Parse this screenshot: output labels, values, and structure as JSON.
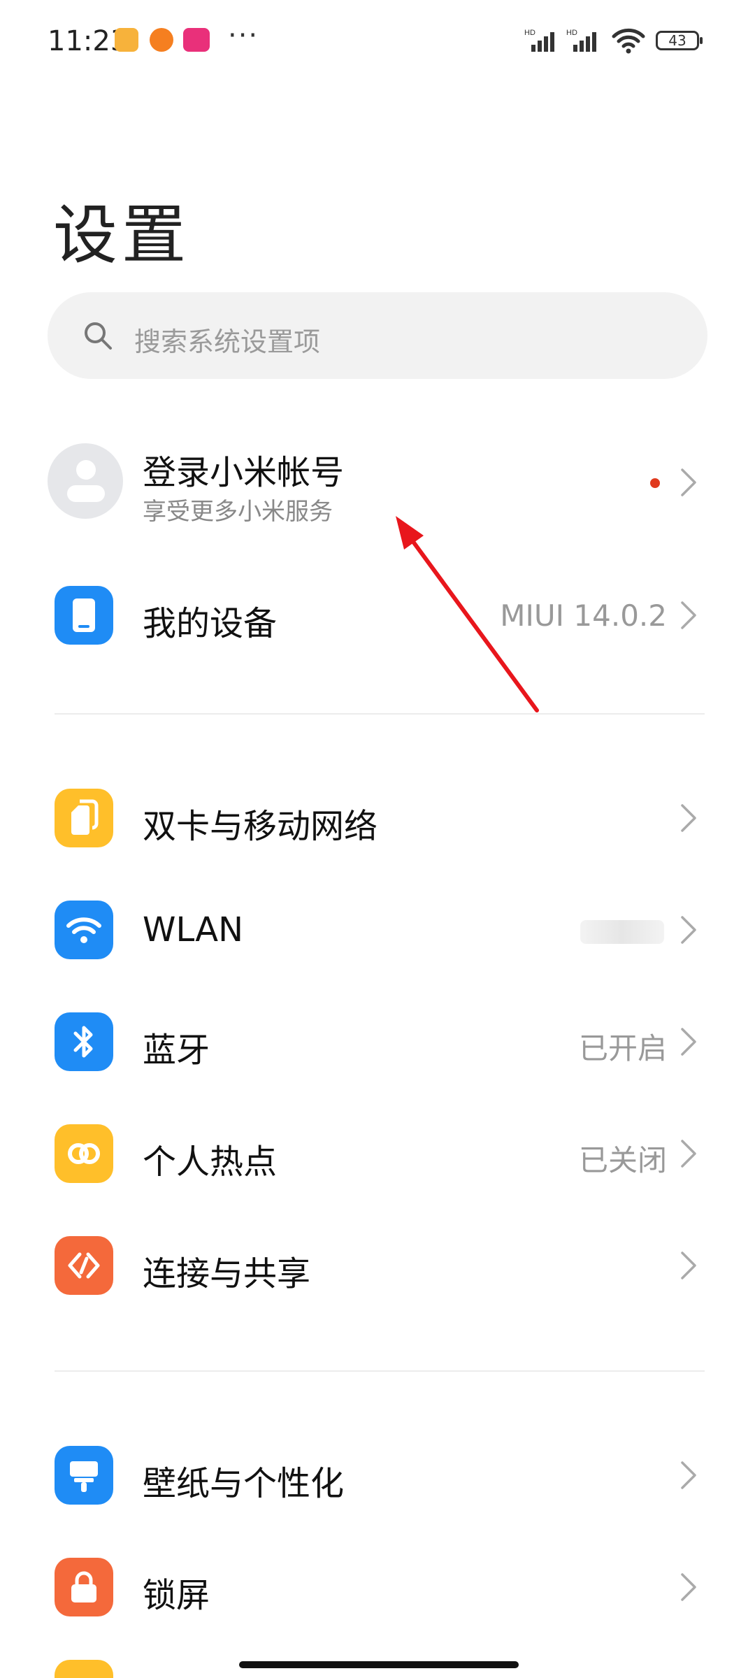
{
  "status_bar": {
    "time": "11:23",
    "notification_dots": "···",
    "signal1_label": "HD",
    "signal2_label": "HD",
    "battery": "43"
  },
  "page_title": "设置",
  "search": {
    "placeholder": "搜索系统设置项"
  },
  "account": {
    "title": "登录小米帐号",
    "subtitle": "享受更多小米服务"
  },
  "items": [
    {
      "label": "我的设备",
      "value": "MIUI 14.0.2",
      "icon": "phone-icon",
      "color": "#1f8cf5"
    },
    {
      "label": "双卡与移动网络",
      "value": "",
      "icon": "sim-card-icon",
      "color": "#ffbf2a"
    },
    {
      "label": "WLAN",
      "value": "",
      "icon": "wifi-icon",
      "color": "#1f8cf5"
    },
    {
      "label": "蓝牙",
      "value": "已开启",
      "icon": "bluetooth-icon",
      "color": "#1f8cf5"
    },
    {
      "label": "个人热点",
      "value": "已关闭",
      "icon": "hotspot-icon",
      "color": "#ffbf2a"
    },
    {
      "label": "连接与共享",
      "value": "",
      "icon": "share-connect-icon",
      "color": "#f4693b"
    },
    {
      "label": "壁纸与个性化",
      "value": "",
      "icon": "wallpaper-icon",
      "color": "#1f8cf5"
    },
    {
      "label": "锁屏",
      "value": "",
      "icon": "lock-icon",
      "color": "#f4693b"
    }
  ],
  "colors": {
    "accent_red": "#e03a1e",
    "arrow_red": "#e8161c"
  }
}
